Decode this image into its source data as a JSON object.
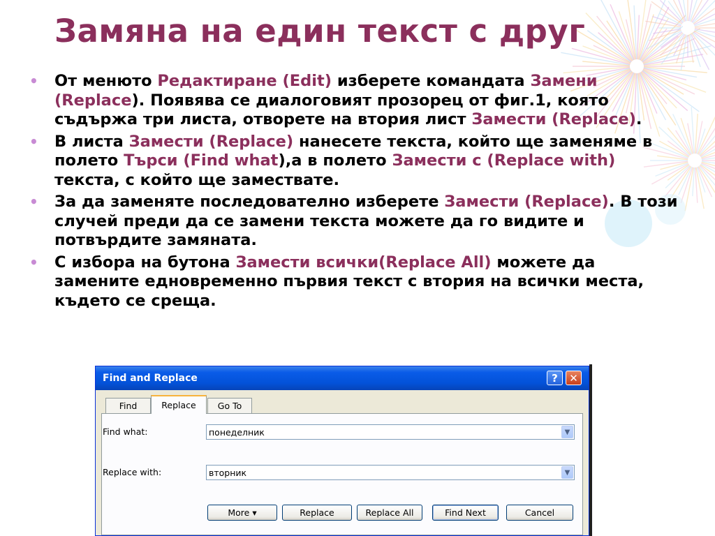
{
  "slide": {
    "title": "Замяна на един текст с друг",
    "bullet_glyph": "•",
    "bullets": [
      [
        {
          "t": "От менюто ",
          "h": false
        },
        {
          "t": "Редактиране (Edit)",
          "h": true
        },
        {
          "t": " изберете командата ",
          "h": false
        },
        {
          "t": "Замени (Replace",
          "h": true
        },
        {
          "t": "). Появява се диалоговият прозорец от фиг.1, която съдържа три листа, отворете на втория лист ",
          "h": false
        },
        {
          "t": "Замести (Replace)",
          "h": true
        },
        {
          "t": ".",
          "h": false
        }
      ],
      [
        {
          "t": "В листа ",
          "h": false
        },
        {
          "t": "Замести (Replace)",
          "h": true
        },
        {
          "t": " нанесете текста, който ще заменяме в полето ",
          "h": false
        },
        {
          "t": "Търси (Find what",
          "h": true
        },
        {
          "t": "),а в полето ",
          "h": false
        },
        {
          "t": "Замести с (Replace with)",
          "h": true
        },
        {
          "t": " текста, с който ще замествате.",
          "h": false
        }
      ],
      [
        {
          "t": "За да заменяте последователно изберете ",
          "h": false
        },
        {
          "t": "Замести (Replace)",
          "h": true
        },
        {
          "t": ". В този случей преди да се замени текста можете да го видите и потвърдите замяната.",
          "h": false
        }
      ],
      [
        {
          "t": "С избора на бутона ",
          "h": false
        },
        {
          "t": "Замести всички(Replace All)",
          "h": true
        },
        {
          "t": " можете да замените едновременно първия текст с втория на всички места, където се среща.",
          "h": false
        }
      ]
    ]
  },
  "dialog": {
    "title": "Find and Replace",
    "help_glyph": "?",
    "close_glyph": "✕",
    "tabs": {
      "find": "Find",
      "replace": "Replace",
      "goto": "Go To"
    },
    "find_what_label": "Find what:",
    "find_what_value": "понеделник",
    "replace_with_label": "Replace with:",
    "replace_with_value": "вторник",
    "dropdown_glyph": "▼",
    "buttons": {
      "more": "More ▾",
      "replace": "Replace",
      "replace_all": "Replace All",
      "find_next": "Find Next",
      "cancel": "Cancel"
    }
  },
  "colors": {
    "accent": "#8b2f5c",
    "bullet": "#c88bd4",
    "titlebar": "#0352d9"
  }
}
